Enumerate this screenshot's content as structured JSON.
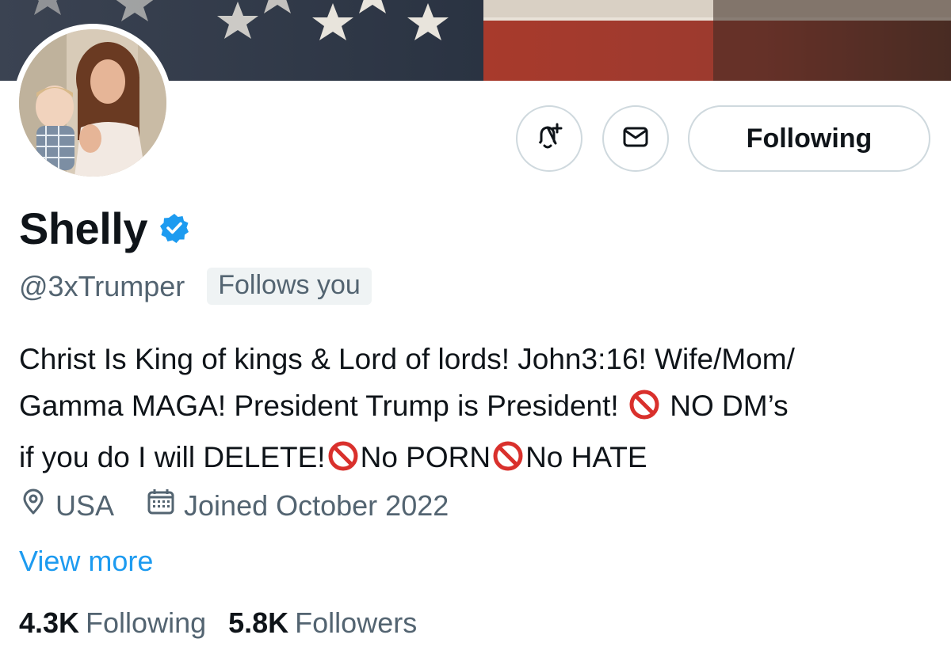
{
  "header": {
    "banner_icon": "american-flag-banner",
    "avatar_icon": "profile-photo-avatar"
  },
  "actions": {
    "notify_icon": "bell-plus-icon",
    "message_icon": "envelope-icon",
    "follow_label": "Following"
  },
  "profile": {
    "name": "Shelly",
    "verified_icon": "verified-badge-icon",
    "handle": "@3xTrumper",
    "follows_you": "Follows you",
    "bio_line1": "Christ Is King of kings & Lord of lords! John3:16! Wife/Mom/",
    "bio_line2": "Gamma MAGA! President Trump is President!",
    "bio_line2_tail": "NO DM’s",
    "bio_line3a": "if you do I will DELETE!",
    "bio_line3b": "No PORN",
    "bio_line3c": "No HATE",
    "prohibited_icon": "prohibited-sign-icon",
    "location": "USA",
    "location_icon": "location-pin-icon",
    "joined": "Joined October 2022",
    "joined_icon": "calendar-icon",
    "view_more": "View more"
  },
  "stats": {
    "following_count": "4.3K",
    "following_label": "Following",
    "followers_count": "5.8K",
    "followers_label": "Followers"
  },
  "colors": {
    "accent": "#1d9bf0",
    "secondary_text": "#536471",
    "primary_text": "#0f1419",
    "border": "#cfd9de",
    "prohibited_red": "#d9302c"
  }
}
